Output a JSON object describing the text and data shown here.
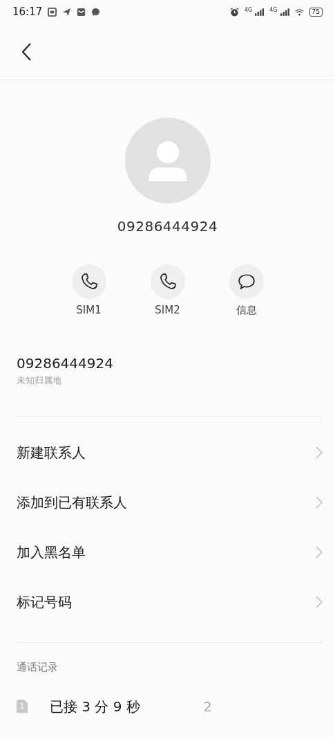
{
  "status_bar": {
    "time": "16:17",
    "network_1": "4G",
    "network_2": "4G",
    "battery": "75"
  },
  "contact": {
    "number": "09286444924"
  },
  "actions": [
    {
      "kind": "call",
      "label": "SIM1"
    },
    {
      "kind": "call",
      "label": "SIM2"
    },
    {
      "kind": "message",
      "label": "信息"
    }
  ],
  "number_info": {
    "number": "09286444924",
    "location": "未知归属地"
  },
  "menu_items": [
    {
      "label": "新建联系人"
    },
    {
      "label": "添加到已有联系人"
    },
    {
      "label": "加入黑名单"
    },
    {
      "label": "标记号码"
    }
  ],
  "call_log": {
    "title": "通话记录",
    "entries": [
      {
        "sim": "1",
        "description": "已接 3 分 9 秒",
        "time": "2"
      }
    ]
  }
}
